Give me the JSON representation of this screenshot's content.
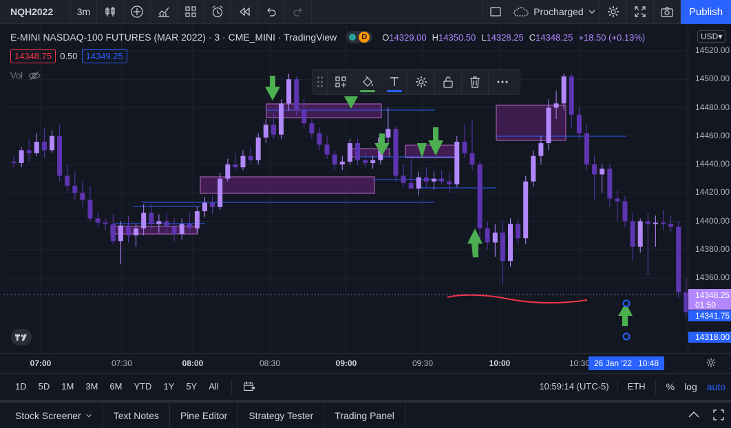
{
  "toolbar": {
    "symbol": "NQH2022",
    "interval": "3m",
    "layout_name": "Procharged",
    "publish_label": "Publish"
  },
  "legend": {
    "title": "E-MINI NASDAQ-100 FUTURES (MAR 2022) · 3 · CME_MINI · TradingView",
    "badge": "D",
    "open_key": "O",
    "open": "14329.00",
    "high_key": "H",
    "high": "14350.50",
    "low_key": "L",
    "low": "14328.25",
    "close_key": "C",
    "close": "14348.25",
    "change": "+18.50 (+0.13%)",
    "bid": "14348.75",
    "spread": "0.50",
    "ask": "14349.25",
    "vol_label": "Vol"
  },
  "price_scale": {
    "currency": "USD",
    "ticks": [
      "14520.00",
      "14500.00",
      "14480.00",
      "14460.00",
      "14440.00",
      "14420.00",
      "14400.00",
      "14380.00",
      "14360.00"
    ],
    "last_price": "14348.25",
    "countdown": "01:50",
    "label_a": "14341.75",
    "label_b": "14318.00"
  },
  "time_scale": {
    "ticks": [
      {
        "label": "07:00",
        "bold": true
      },
      {
        "label": "07:30",
        "bold": false
      },
      {
        "label": "08:00",
        "bold": true
      },
      {
        "label": "08:30",
        "bold": false
      },
      {
        "label": "09:00",
        "bold": true
      },
      {
        "label": "09:30",
        "bold": false
      },
      {
        "label": "10:00",
        "bold": true
      },
      {
        "label": "10:30",
        "bold": false
      }
    ],
    "crosshair_date": "26 Jan '22",
    "crosshair_time": "10:48"
  },
  "range_bar": {
    "ranges": [
      "1D",
      "5D",
      "1M",
      "3M",
      "6M",
      "YTD",
      "1Y",
      "5Y",
      "All"
    ],
    "clock": "10:59:14 (UTC-5)",
    "session": "ETH",
    "percent": "%",
    "log": "log",
    "auto": "auto"
  },
  "panels": [
    "Stock Screener",
    "Text Notes",
    "Pine Editor",
    "Strategy Tester",
    "Trading Panel"
  ],
  "colors": {
    "bull": "#b388ff",
    "bear": "#5e35b1",
    "accent": "#2962ff",
    "zone": "#9c27b0",
    "arrow": "#4caf50",
    "drawing": "#f23645"
  },
  "chart_data": {
    "type": "candlestick",
    "ylim": [
      14300,
      14535
    ],
    "candles": [
      {
        "o": 14442,
        "h": 14446,
        "l": 14438,
        "c": 14441
      },
      {
        "o": 14441,
        "h": 14452,
        "l": 14438,
        "c": 14450
      },
      {
        "o": 14450,
        "h": 14458,
        "l": 14442,
        "c": 14448
      },
      {
        "o": 14448,
        "h": 14462,
        "l": 14446,
        "c": 14456
      },
      {
        "o": 14456,
        "h": 14466,
        "l": 14445,
        "c": 14450
      },
      {
        "o": 14450,
        "h": 14464,
        "l": 14448,
        "c": 14460
      },
      {
        "o": 14460,
        "h": 14468,
        "l": 14428,
        "c": 14432
      },
      {
        "o": 14432,
        "h": 14440,
        "l": 14420,
        "c": 14425
      },
      {
        "o": 14425,
        "h": 14435,
        "l": 14415,
        "c": 14420
      },
      {
        "o": 14420,
        "h": 14428,
        "l": 14410,
        "c": 14415
      },
      {
        "o": 14415,
        "h": 14425,
        "l": 14400,
        "c": 14402
      },
      {
        "o": 14402,
        "h": 14406,
        "l": 14396,
        "c": 14399
      },
      {
        "o": 14399,
        "h": 14402,
        "l": 14394,
        "c": 14398
      },
      {
        "o": 14398,
        "h": 14405,
        "l": 14384,
        "c": 14386
      },
      {
        "o": 14386,
        "h": 14400,
        "l": 14370,
        "c": 14397
      },
      {
        "o": 14397,
        "h": 14404,
        "l": 14385,
        "c": 14390
      },
      {
        "o": 14390,
        "h": 14398,
        "l": 14382,
        "c": 14395
      },
      {
        "o": 14395,
        "h": 14412,
        "l": 14390,
        "c": 14406
      },
      {
        "o": 14406,
        "h": 14412,
        "l": 14394,
        "c": 14398
      },
      {
        "o": 14398,
        "h": 14405,
        "l": 14392,
        "c": 14400
      },
      {
        "o": 14400,
        "h": 14406,
        "l": 14390,
        "c": 14396
      },
      {
        "o": 14396,
        "h": 14402,
        "l": 14386,
        "c": 14391
      },
      {
        "o": 14391,
        "h": 14402,
        "l": 14387,
        "c": 14398
      },
      {
        "o": 14398,
        "h": 14406,
        "l": 14392,
        "c": 14395
      },
      {
        "o": 14395,
        "h": 14410,
        "l": 14392,
        "c": 14407
      },
      {
        "o": 14407,
        "h": 14417,
        "l": 14403,
        "c": 14413
      },
      {
        "o": 14413,
        "h": 14418,
        "l": 14405,
        "c": 14410
      },
      {
        "o": 14410,
        "h": 14434,
        "l": 14408,
        "c": 14430
      },
      {
        "o": 14430,
        "h": 14444,
        "l": 14428,
        "c": 14440
      },
      {
        "o": 14440,
        "h": 14448,
        "l": 14436,
        "c": 14438
      },
      {
        "o": 14438,
        "h": 14450,
        "l": 14436,
        "c": 14446
      },
      {
        "o": 14446,
        "h": 14452,
        "l": 14440,
        "c": 14443
      },
      {
        "o": 14443,
        "h": 14462,
        "l": 14440,
        "c": 14459
      },
      {
        "o": 14459,
        "h": 14472,
        "l": 14455,
        "c": 14468
      },
      {
        "o": 14468,
        "h": 14476,
        "l": 14458,
        "c": 14461
      },
      {
        "o": 14461,
        "h": 14486,
        "l": 14458,
        "c": 14483
      },
      {
        "o": 14483,
        "h": 14504,
        "l": 14478,
        "c": 14500
      },
      {
        "o": 14500,
        "h": 14502,
        "l": 14474,
        "c": 14478
      },
      {
        "o": 14478,
        "h": 14486,
        "l": 14466,
        "c": 14469
      },
      {
        "o": 14469,
        "h": 14472,
        "l": 14458,
        "c": 14462
      },
      {
        "o": 14462,
        "h": 14466,
        "l": 14450,
        "c": 14454
      },
      {
        "o": 14454,
        "h": 14460,
        "l": 14444,
        "c": 14447
      },
      {
        "o": 14447,
        "h": 14450,
        "l": 14436,
        "c": 14440
      },
      {
        "o": 14440,
        "h": 14446,
        "l": 14436,
        "c": 14442
      },
      {
        "o": 14442,
        "h": 14458,
        "l": 14440,
        "c": 14455
      },
      {
        "o": 14455,
        "h": 14458,
        "l": 14440,
        "c": 14443
      },
      {
        "o": 14443,
        "h": 14448,
        "l": 14438,
        "c": 14441
      },
      {
        "o": 14441,
        "h": 14446,
        "l": 14437,
        "c": 14443
      },
      {
        "o": 14443,
        "h": 14462,
        "l": 14440,
        "c": 14459
      },
      {
        "o": 14459,
        "h": 14480,
        "l": 14455,
        "c": 14465
      },
      {
        "o": 14465,
        "h": 14467,
        "l": 14428,
        "c": 14432
      },
      {
        "o": 14432,
        "h": 14440,
        "l": 14424,
        "c": 14427
      },
      {
        "o": 14427,
        "h": 14444,
        "l": 14424,
        "c": 14423
      },
      {
        "o": 14423,
        "h": 14435,
        "l": 14418,
        "c": 14431
      },
      {
        "o": 14431,
        "h": 14438,
        "l": 14424,
        "c": 14428
      },
      {
        "o": 14428,
        "h": 14435,
        "l": 14422,
        "c": 14430
      },
      {
        "o": 14430,
        "h": 14436,
        "l": 14426,
        "c": 14428
      },
      {
        "o": 14428,
        "h": 14434,
        "l": 14420,
        "c": 14426
      },
      {
        "o": 14426,
        "h": 14460,
        "l": 14424,
        "c": 14456
      },
      {
        "o": 14456,
        "h": 14468,
        "l": 14445,
        "c": 14448
      },
      {
        "o": 14448,
        "h": 14472,
        "l": 14436,
        "c": 14440
      },
      {
        "o": 14440,
        "h": 14442,
        "l": 14388,
        "c": 14395
      },
      {
        "o": 14395,
        "h": 14400,
        "l": 14380,
        "c": 14385
      },
      {
        "o": 14385,
        "h": 14398,
        "l": 14375,
        "c": 14392
      },
      {
        "o": 14392,
        "h": 14400,
        "l": 14355,
        "c": 14372
      },
      {
        "o": 14372,
        "h": 14402,
        "l": 14368,
        "c": 14398
      },
      {
        "o": 14398,
        "h": 14402,
        "l": 14384,
        "c": 14388
      },
      {
        "o": 14388,
        "h": 14432,
        "l": 14384,
        "c": 14428
      },
      {
        "o": 14428,
        "h": 14450,
        "l": 14424,
        "c": 14446
      },
      {
        "o": 14446,
        "h": 14460,
        "l": 14440,
        "c": 14455
      },
      {
        "o": 14455,
        "h": 14486,
        "l": 14450,
        "c": 14480
      },
      {
        "o": 14480,
        "h": 14492,
        "l": 14472,
        "c": 14483
      },
      {
        "o": 14483,
        "h": 14504,
        "l": 14478,
        "c": 14502
      },
      {
        "o": 14502,
        "h": 14504,
        "l": 14466,
        "c": 14475
      },
      {
        "o": 14475,
        "h": 14480,
        "l": 14458,
        "c": 14462
      },
      {
        "o": 14462,
        "h": 14468,
        "l": 14436,
        "c": 14440
      },
      {
        "o": 14440,
        "h": 14446,
        "l": 14415,
        "c": 14433
      },
      {
        "o": 14433,
        "h": 14440,
        "l": 14420,
        "c": 14437
      },
      {
        "o": 14437,
        "h": 14440,
        "l": 14410,
        "c": 14416
      },
      {
        "o": 14416,
        "h": 14422,
        "l": 14400,
        "c": 14414
      },
      {
        "o": 14414,
        "h": 14418,
        "l": 14396,
        "c": 14400
      },
      {
        "o": 14400,
        "h": 14406,
        "l": 14372,
        "c": 14382
      },
      {
        "o": 14382,
        "h": 14402,
        "l": 14378,
        "c": 14400
      },
      {
        "o": 14400,
        "h": 14406,
        "l": 14362,
        "c": 14398
      },
      {
        "o": 14398,
        "h": 14404,
        "l": 14382,
        "c": 14399
      },
      {
        "o": 14399,
        "h": 14408,
        "l": 14394,
        "c": 14398
      },
      {
        "o": 14398,
        "h": 14404,
        "l": 14392,
        "c": 14396
      },
      {
        "o": 14396,
        "h": 14400,
        "l": 14346,
        "c": 14350
      },
      {
        "o": 14350,
        "h": 14360,
        "l": 14332,
        "c": 14336
      },
      {
        "o": 14329,
        "h": 14350.5,
        "l": 14328.25,
        "c": 14348.25
      }
    ]
  }
}
